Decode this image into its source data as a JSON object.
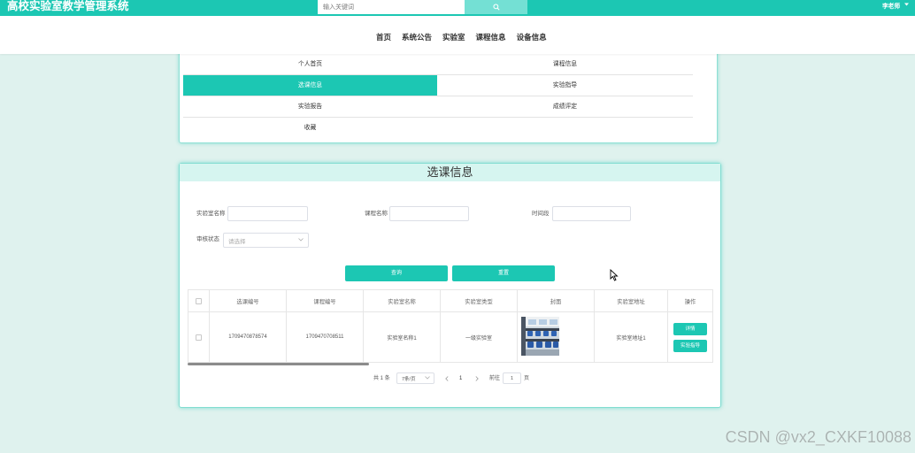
{
  "app": {
    "title": "高校实验室教学管理系统"
  },
  "header": {
    "search": {
      "placeholder": "输入关键词",
      "value": "",
      "icon": "search-icon"
    },
    "user": {
      "name": "李老师",
      "icon": "chevron-down-icon"
    }
  },
  "nav": {
    "items": [
      {
        "label": "首页"
      },
      {
        "label": "系统公告"
      },
      {
        "label": "实验室"
      },
      {
        "label": "课程信息"
      },
      {
        "label": "设备信息"
      }
    ]
  },
  "menu": {
    "items": [
      {
        "label": "个人首页"
      },
      {
        "label": "课程信息"
      },
      {
        "label": "选课信息",
        "active": true
      },
      {
        "label": "实验指导"
      },
      {
        "label": "实验报告"
      },
      {
        "label": "成绩评定"
      },
      {
        "label": "收藏"
      }
    ]
  },
  "panel": {
    "title": "选课信息",
    "filters": {
      "lab_name": {
        "label": "实验室名称",
        "value": ""
      },
      "course_name": {
        "label": "课程名称",
        "value": ""
      },
      "time_slot": {
        "label": "时间段",
        "value": ""
      },
      "review_status": {
        "label": "审核状态",
        "placeholder": "请选择",
        "icon": "chevron-down-icon"
      }
    },
    "buttons": {
      "search": "查询",
      "reset": "重置"
    },
    "table": {
      "columns": [
        "选课编号",
        "课程编号",
        "实验室名称",
        "实验室类型",
        "封面",
        "实验室地址",
        "操作"
      ],
      "rows": [
        {
          "selection_no": "1709470878574",
          "course_no": "1709470708511",
          "lab_name": "实验室名称1",
          "lab_type": "一级实验室",
          "cover_image": "lab-photo-image",
          "lab_address": "实验室地址1",
          "actions": [
            "详情",
            "实验指导"
          ]
        }
      ]
    },
    "pagination": {
      "total_text": "共 1 条",
      "page_size": "7条/页",
      "current_page": "1",
      "goto_label": "前往",
      "goto_value": "1",
      "goto_suffix": "页",
      "prev_icon": "chevron-left-icon",
      "next_icon": "chevron-right-icon"
    }
  },
  "watermark": "CSDN @vx2_CXKF10088",
  "colors": {
    "primary": "#1cc7b3",
    "page_background": "#dff2ee",
    "search_button": "#74e0d4",
    "panel_title_background": "#d6f5f0"
  }
}
